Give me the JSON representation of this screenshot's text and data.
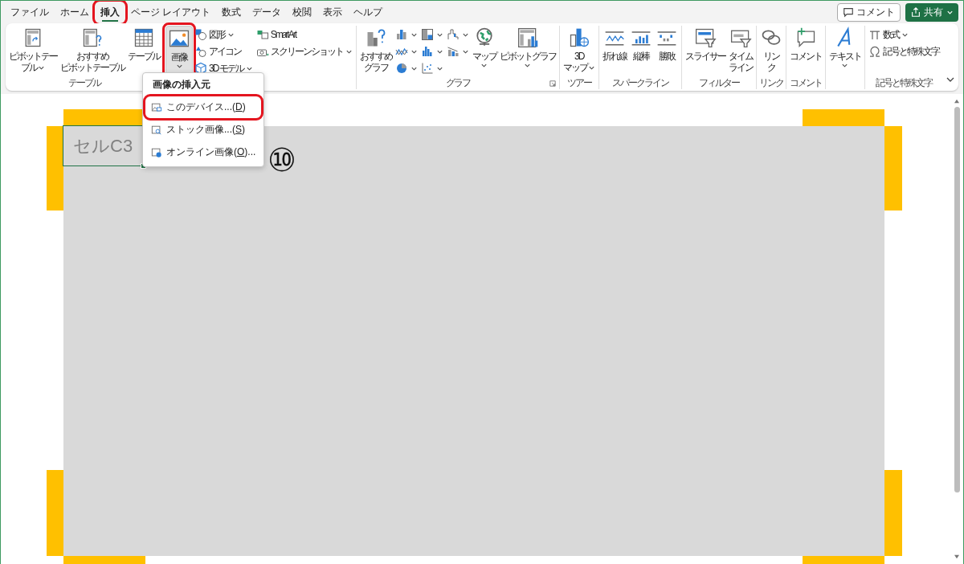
{
  "tabs": [
    {
      "label": "ファイル",
      "selected": false,
      "annotated": false
    },
    {
      "label": "ホーム",
      "selected": false,
      "annotated": false
    },
    {
      "label": "挿入",
      "selected": true,
      "annotated": true
    },
    {
      "label": "ページ レイアウト",
      "selected": false,
      "annotated": false
    },
    {
      "label": "数式",
      "selected": false,
      "annotated": false
    },
    {
      "label": "データ",
      "selected": false,
      "annotated": false
    },
    {
      "label": "校閲",
      "selected": false,
      "annotated": false
    },
    {
      "label": "表示",
      "selected": false,
      "annotated": false
    },
    {
      "label": "ヘルプ",
      "selected": false,
      "annotated": false
    }
  ],
  "header_buttons": {
    "comment": "コメント",
    "share": "共有"
  },
  "ribbon": {
    "groups": [
      {
        "label": "テーブル",
        "commands": [
          {
            "kind": "large",
            "lines": [
              "ピボットテー",
              "ブル"
            ],
            "dropdown": true
          },
          {
            "kind": "large",
            "lines": [
              "おすすめ",
              "ピボットテーブル"
            ]
          },
          {
            "kind": "large",
            "lines": [
              "テーブル"
            ]
          }
        ]
      },
      {
        "commands": [
          {
            "kind": "large",
            "lines": [
              "画像"
            ],
            "dropdown": true,
            "pressed": true,
            "annotated": true
          },
          {
            "kind": "stack",
            "items": [
              {
                "label": "図形",
                "dropdown": true
              },
              {
                "label": "アイコン"
              },
              {
                "label": "3D モデル",
                "dropdown": true
              }
            ]
          },
          {
            "kind": "stack",
            "items": [
              {
                "label": "SmartArt"
              },
              {
                "label": "スクリーンショット",
                "dropdown": true
              }
            ]
          }
        ]
      },
      {
        "label": "グラフ",
        "launcher": true,
        "commands": [
          {
            "kind": "large",
            "lines": [
              "おすすめ",
              "グラフ"
            ]
          },
          {
            "kind": "stack",
            "items": [
              {
                "dropdown": true
              },
              {
                "dropdown": true
              },
              {
                "dropdown": true
              }
            ]
          },
          {
            "kind": "stack",
            "items": [
              {
                "dropdown": true
              },
              {
                "dropdown": true
              },
              {
                "dropdown": true
              }
            ]
          },
          {
            "kind": "stack",
            "items": [
              {
                "dropdown": true
              },
              {
                "dropdown": true
              }
            ]
          },
          {
            "kind": "large",
            "lines": [
              "マップ"
            ],
            "dropdown": true
          },
          {
            "kind": "large",
            "lines": [
              "ピボットグラフ"
            ],
            "dropdown": true
          }
        ]
      },
      {
        "label": "ツアー",
        "commands": [
          {
            "kind": "large",
            "lines": [
              "3D",
              "マップ"
            ],
            "dropdown": true
          }
        ]
      },
      {
        "label": "スパークライン",
        "commands": [
          {
            "kind": "large",
            "lines": [
              "折れ線"
            ]
          },
          {
            "kind": "large",
            "lines": [
              "縦棒"
            ]
          },
          {
            "kind": "large",
            "lines": [
              "勝敗"
            ]
          }
        ]
      },
      {
        "label": "フィルター",
        "commands": [
          {
            "kind": "large",
            "lines": [
              "スライサー"
            ]
          },
          {
            "kind": "large",
            "lines": [
              "タイム",
              "ライン"
            ]
          }
        ]
      },
      {
        "label": "リンク",
        "commands": [
          {
            "kind": "large",
            "lines": [
              "リン",
              "ク"
            ]
          }
        ]
      },
      {
        "label": "コメント",
        "commands": [
          {
            "kind": "large",
            "lines": [
              "コメント"
            ]
          }
        ]
      },
      {
        "commands": [
          {
            "kind": "large",
            "lines": [
              "テキスト"
            ],
            "dropdown": true
          }
        ]
      },
      {
        "label": "記号と特殊文字",
        "commands": [
          {
            "kind": "stack",
            "items": [
              {
                "label": "数式",
                "dropdown": true
              },
              {
                "label": "記号と特殊文字"
              }
            ]
          }
        ]
      }
    ]
  },
  "image_menu": {
    "title": "画像の挿入元",
    "items": [
      {
        "label_before": "このデバイス...(",
        "access_key": "D",
        "label_after": ")",
        "annotated": true
      },
      {
        "label_before": "ストック画像...(",
        "access_key": "S",
        "label_after": ")",
        "annotated": false
      },
      {
        "label_before": "オンライン画像(",
        "access_key": "O",
        "label_after": ")...",
        "annotated": false
      }
    ]
  },
  "sheet": {
    "cell_text": "セルC3",
    "step_number": "⑩"
  }
}
